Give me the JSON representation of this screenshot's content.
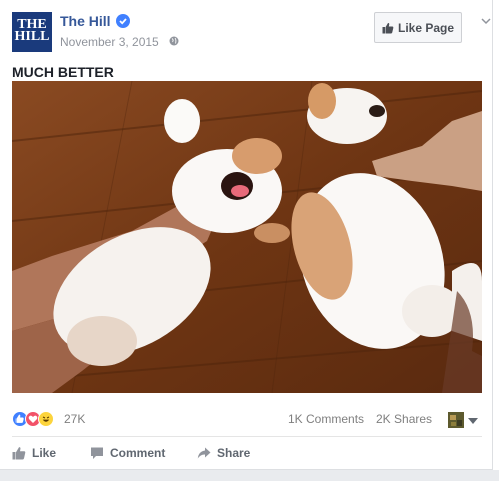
{
  "post": {
    "page_name": "The Hill",
    "avatar_text_line1": "THE",
    "avatar_text_line2": "HILL",
    "timestamp": "November 3, 2015",
    "like_page_label": "Like Page",
    "text": "MUCH BETTER"
  },
  "stats": {
    "reaction_count": "27K",
    "comments": "1K Comments",
    "shares": "2K Shares"
  },
  "actions": {
    "like": "Like",
    "comment": "Comment",
    "share": "Share"
  },
  "icons": {
    "verified": "verified-badge-icon",
    "globe": "globe-icon",
    "thumbs_up": "thumbs-up-icon",
    "comment": "comment-icon",
    "share": "share-icon"
  },
  "colors": {
    "link": "#365899",
    "brand": "#1a3a7c",
    "like": "#4080ff",
    "love": "#f25268",
    "haha": "#fcd43d",
    "muted": "#90949c"
  }
}
